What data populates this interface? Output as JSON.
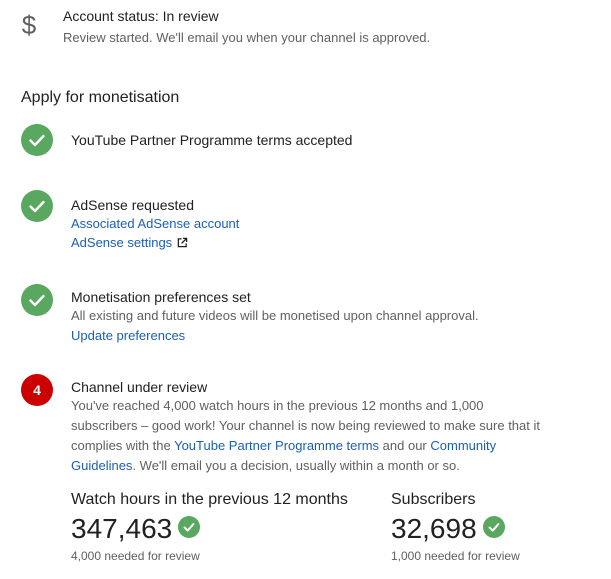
{
  "account_status": {
    "icon": "dollar-icon",
    "title": "Account status: In review",
    "subtitle": "Review started. We'll email you when your channel is approved."
  },
  "section_title": "Apply for monetisation",
  "steps": [
    {
      "status": "done",
      "title": "YouTube Partner Programme terms accepted"
    },
    {
      "status": "done",
      "title": "AdSense requested",
      "links": [
        "Associated AdSense account",
        "AdSense settings"
      ]
    },
    {
      "status": "done",
      "title": "Monetisation preferences set",
      "description": "All existing and future videos will be monetised upon channel approval.",
      "links": [
        "Update preferences"
      ]
    },
    {
      "status": "pending",
      "number": "4",
      "title": "Channel under review",
      "description_parts": [
        "You've reached 4,000 watch hours in the previous 12 months and 1,000 subscribers – good work! Your channel is now being reviewed to make sure that it complies with the ",
        "YouTube Partner Programme terms",
        " and our ",
        "Community Guidelines",
        ". We'll email you a decision, usually within a month or so."
      ]
    }
  ],
  "stats": [
    {
      "label": "Watch hours in the previous 12 months",
      "value": "347,463",
      "note": "4,000 needed for review"
    },
    {
      "label": "Subscribers",
      "value": "32,698",
      "note": "1,000 needed for review"
    }
  ],
  "colors": {
    "success": "#5aa85f",
    "error": "#cc0000",
    "link": "#1a5fb4",
    "secondary_text": "#606060"
  }
}
